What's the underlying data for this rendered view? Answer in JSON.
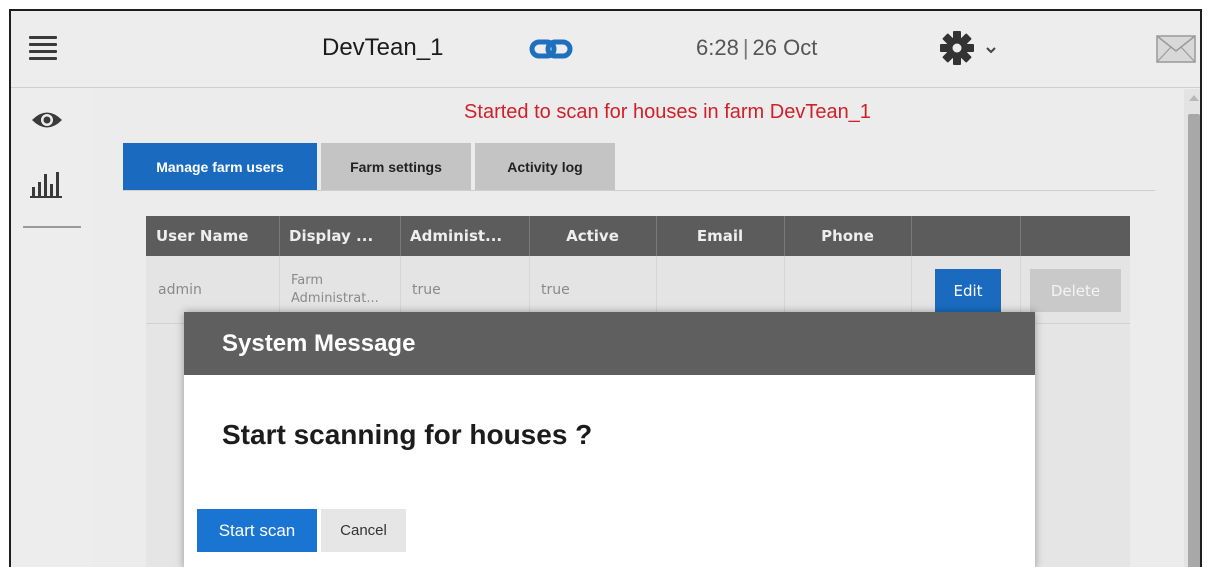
{
  "header": {
    "farm_name": "DevTean_1",
    "time": "6:28",
    "date": "26 Oct",
    "icons": [
      "menu-icon",
      "link-icon",
      "gear-icon",
      "chevron-down-icon",
      "mail-icon"
    ]
  },
  "sidebar": {
    "icons": [
      "eye-icon",
      "bar-chart-icon"
    ]
  },
  "status_message": "Started to scan for houses in farm DevTean_1",
  "tabs": [
    {
      "label": "Manage farm users",
      "active": true
    },
    {
      "label": "Farm settings",
      "active": false
    },
    {
      "label": "Activity log",
      "active": false
    }
  ],
  "table": {
    "columns": [
      "User Name",
      "Display ...",
      "Administ...",
      "Active",
      "Email",
      "Phone",
      "",
      ""
    ],
    "rows": [
      {
        "user_name": "admin",
        "display_name_line1": "Farm",
        "display_name_line2": "Administrat...",
        "administrator": "true",
        "active": "true",
        "email": "",
        "phone": "",
        "edit_label": "Edit",
        "delete_label": "Delete"
      }
    ]
  },
  "modal": {
    "title": "System Message",
    "message": "Start scanning for houses ?",
    "primary_label": "Start scan",
    "secondary_label": "Cancel"
  },
  "colors": {
    "accent": "#1a6bc0",
    "status_text": "#d0202a",
    "header_bar": "#5f5f5f",
    "link_icon": "#1f6fbf"
  }
}
